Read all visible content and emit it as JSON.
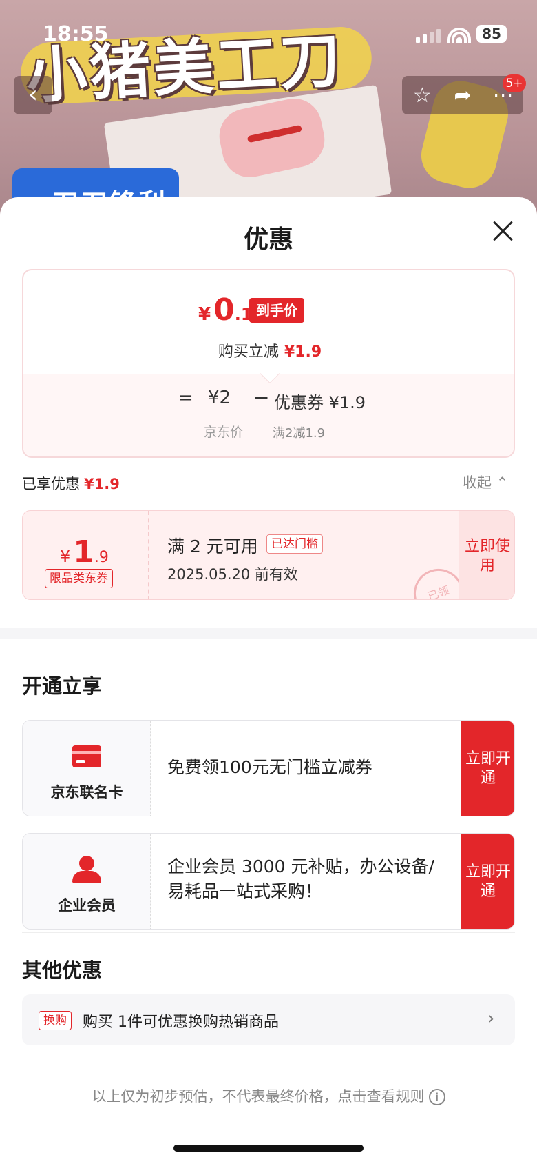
{
  "status_bar": {
    "time": "18:55",
    "battery": "85"
  },
  "product_bg": {
    "title": "小猪美工刀",
    "badge_text": "刀刀锋利"
  },
  "nav": {
    "back_icon": "chevron-left-icon",
    "cart_badge": "5+"
  },
  "sheet": {
    "title": "优惠",
    "final_price": {
      "yen": "¥",
      "int": "0",
      "dec": ".1",
      "tag": "到手价"
    },
    "instant_discount": {
      "label": "购买立减",
      "amount": "¥1.9"
    },
    "breakdown": {
      "equals": "=",
      "jd_price": "¥2",
      "jd_price_label": "京东价",
      "minus": "−",
      "coupon": "优惠券 ¥1.9",
      "coupon_rule": "满2减1.9"
    },
    "enjoyed": {
      "label": "已享优惠",
      "amount": "¥1.9",
      "collapse": "收起"
    },
    "coupon_card": {
      "yen": "¥",
      "int": "1",
      "dec": ".9",
      "type": "限品类东券",
      "condition": "满 2 元可用",
      "reached": "已达门槛",
      "valid": "2025.05.20 前有效",
      "button": "立即使用",
      "stamp": "已领"
    },
    "open_section": {
      "title": "开通立享",
      "offers": [
        {
          "name": "京东联名卡",
          "icon": "credit-card-icon",
          "text": "免费领100元无门槛立减券",
          "button": "立即开通"
        },
        {
          "name": "企业会员",
          "icon": "user-icon",
          "text": " 企业会员 3000 元补贴，办公设备/易耗品一站式采购！",
          "button": "立即开通"
        }
      ]
    },
    "other_section": {
      "title": "其他优惠",
      "row": {
        "tag": "换购",
        "text": "购买 1件可优惠换购热销商品"
      }
    },
    "footer": "以上仅为初步预估，不代表最终价格，点击查看规则"
  },
  "colors": {
    "accent": "#e3262a",
    "coupon_bg": "#fff0f0"
  }
}
